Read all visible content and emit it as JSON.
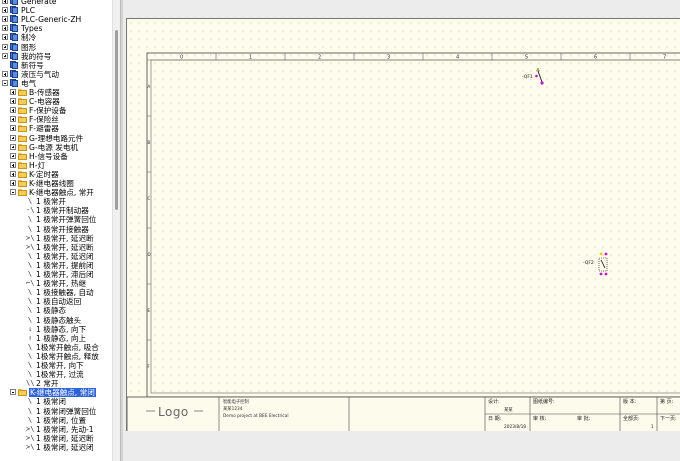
{
  "tree": {
    "items": [
      {
        "label": "Generate",
        "type": "lib",
        "level": 0,
        "expander": "plus"
      },
      {
        "label": "PLC",
        "type": "lib",
        "level": 0,
        "expander": "plus"
      },
      {
        "label": "PLC-Generic-ZH",
        "type": "lib",
        "level": 0,
        "expander": "plus"
      },
      {
        "label": "Types",
        "type": "lib",
        "level": 0,
        "expander": "plus"
      },
      {
        "label": "制冷",
        "type": "lib",
        "level": 0,
        "expander": "plus"
      },
      {
        "label": "图形",
        "type": "lib",
        "level": 0,
        "expander": "plus"
      },
      {
        "label": "我的符号",
        "type": "lib",
        "level": 0,
        "expander": "plus"
      },
      {
        "label": "新符号",
        "type": "lib",
        "level": 0,
        "expander": "none"
      },
      {
        "label": "液压与气动",
        "type": "lib",
        "level": 0,
        "expander": "plus"
      },
      {
        "label": "电气",
        "type": "lib",
        "level": 0,
        "expander": "minus"
      },
      {
        "label": "B-传感器",
        "type": "folder",
        "level": 1,
        "expander": "plus"
      },
      {
        "label": "C-电容器",
        "type": "folder",
        "level": 1,
        "expander": "plus"
      },
      {
        "label": "F-保护设备",
        "type": "folder",
        "level": 1,
        "expander": "plus"
      },
      {
        "label": "F-保险丝",
        "type": "folder",
        "level": 1,
        "expander": "plus"
      },
      {
        "label": "F-避雷器",
        "type": "folder",
        "level": 1,
        "expander": "plus"
      },
      {
        "label": "G-理想电路元件",
        "type": "folder",
        "level": 1,
        "expander": "plus"
      },
      {
        "label": "G-电源 发电机",
        "type": "folder",
        "level": 1,
        "expander": "plus"
      },
      {
        "label": "H-信号设备",
        "type": "folder",
        "level": 1,
        "expander": "plus"
      },
      {
        "label": "H-灯",
        "type": "folder",
        "level": 1,
        "expander": "plus"
      },
      {
        "label": "K-定时器",
        "type": "folder",
        "level": 1,
        "expander": "plus"
      },
      {
        "label": "K-继电器线圈",
        "type": "folder",
        "level": 1,
        "expander": "plus"
      },
      {
        "label": "K-继电器触点, 常开",
        "type": "folder",
        "level": 1,
        "expander": "minus"
      },
      {
        "label": "1 极常开",
        "type": "sym",
        "level": 2,
        "glyph": "\\"
      },
      {
        "label": "1 极常开制动器",
        "type": "sym",
        "level": 2,
        "glyph": "-\\"
      },
      {
        "label": "1 极常开弹簧回位",
        "type": "sym",
        "level": 2,
        "glyph": "\\"
      },
      {
        "label": "1 极常开接触器",
        "type": "sym",
        "level": 2,
        "glyph": "\\"
      },
      {
        "label": "1 极常开, 延迟断",
        "type": "sym",
        "level": 2,
        "glyph": "≻\\"
      },
      {
        "label": "1 极常开, 延迟断",
        "type": "sym",
        "level": 2,
        "glyph": "≻\\"
      },
      {
        "label": "1 极常开, 延迟闭",
        "type": "sym",
        "level": 2,
        "glyph": "\\"
      },
      {
        "label": "1 极常开, 提前闭",
        "type": "sym",
        "level": 2,
        "glyph": "\\"
      },
      {
        "label": "1 极常开, 滞后闭",
        "type": "sym",
        "level": 2,
        "glyph": "\\"
      },
      {
        "label": "1 极常开, 热继",
        "type": "sym",
        "level": 2,
        "glyph": "⌐\\"
      },
      {
        "label": "1 极接触器, 自动",
        "type": "sym",
        "level": 2,
        "glyph": "\\"
      },
      {
        "label": "1 极自动返回",
        "type": "sym",
        "level": 2,
        "glyph": "\\"
      },
      {
        "label": "1 极静态",
        "type": "sym",
        "level": 2,
        "glyph": "\\"
      },
      {
        "label": "1 极静态触头",
        "type": "sym",
        "level": 2,
        "glyph": "\\"
      },
      {
        "label": "1 极静态, 向下",
        "type": "sym",
        "level": 2,
        "glyph": "⇂"
      },
      {
        "label": "1 极静态, 向上",
        "type": "sym",
        "level": 2,
        "glyph": "↾"
      },
      {
        "label": "1极常开触点, 吸合",
        "type": "sym",
        "level": 2,
        "glyph": "\\"
      },
      {
        "label": "1极常开触点, 释放",
        "type": "sym",
        "level": 2,
        "glyph": "\\"
      },
      {
        "label": "1极常开, 向下",
        "type": "sym",
        "level": 2,
        "glyph": "\\"
      },
      {
        "label": "1极常开, 过流",
        "type": "sym",
        "level": 2,
        "glyph": "\\"
      },
      {
        "label": "2 常开",
        "type": "sym",
        "level": 2,
        "glyph": "\\\\"
      },
      {
        "label": "K-继电器触点, 常闭",
        "type": "folder",
        "level": 1,
        "expander": "minus",
        "selected": true
      },
      {
        "label": "1 极常闭",
        "type": "sym",
        "level": 2,
        "glyph": "\\"
      },
      {
        "label": "1 极常闭弹簧回位",
        "type": "sym",
        "level": 2,
        "glyph": "\\"
      },
      {
        "label": "1 极常闭, 位置",
        "type": "sym",
        "level": 2,
        "glyph": "\\"
      },
      {
        "label": "1 极常闭, 先动-1",
        "type": "sym",
        "level": 2,
        "glyph": "≻\\"
      },
      {
        "label": "1 极常闭, 延迟断",
        "type": "sym",
        "level": 2,
        "glyph": "≻\\"
      },
      {
        "label": "1 极常闭, 延迟闭",
        "type": "sym",
        "level": 2,
        "glyph": "≻\\"
      }
    ]
  },
  "sheet": {
    "columns": [
      "0",
      "1",
      "2",
      "3",
      "4",
      "5",
      "6",
      "7"
    ],
    "rows": [
      "A",
      "B",
      "C",
      "D",
      "E",
      "F"
    ],
    "logo": "Logo",
    "company_line1": "智能电子控制",
    "company_line2": "某某1234",
    "company_line3": "Demo project at BEE Electrical",
    "tb_label_drawn": "设计:",
    "tb_value_drawn": "某某",
    "tb_label_project": "图纸编号:",
    "tb_label_version": "版 本:",
    "tb_label_sheet": "第  页:",
    "tb_label_date": "日 期:",
    "tb_value_date": "2023/8/18",
    "tb_label_checked": "审 核:",
    "tb_label_approved": "审 批:",
    "tb_label_total": "全部页:",
    "tb_value_total": "1",
    "tb_label_next": "下一页:",
    "components": [
      {
        "tag": "-QF1",
        "name": "component-qf1"
      },
      {
        "tag": "-QF2",
        "name": "component-qf2"
      }
    ]
  },
  "colors": {
    "paper": "#fdfbeb",
    "selection": "#2f63d8",
    "pin_yellow": "#e6d21b",
    "pin_magenta": "#c018c8"
  }
}
